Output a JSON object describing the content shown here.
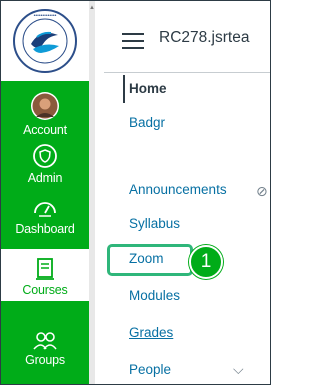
{
  "header": {
    "crumb": "RC278.jsrtea"
  },
  "global_nav": {
    "logo_icon": "college-seal-logo",
    "items": [
      {
        "label": "Account",
        "icon": "avatar-icon"
      },
      {
        "label": "Admin",
        "icon": "shield-icon"
      },
      {
        "label": "Dashboard",
        "icon": "dashboard-icon"
      },
      {
        "label": "Courses",
        "icon": "book-icon"
      },
      {
        "label": "Groups",
        "icon": "groups-icon"
      }
    ]
  },
  "course_nav": {
    "items": [
      {
        "label": "Home"
      },
      {
        "label": "Badgr"
      },
      {
        "label": "Announcements"
      },
      {
        "label": "Syllabus"
      },
      {
        "label": "Zoom"
      },
      {
        "label": "Modules"
      },
      {
        "label": "Grades"
      },
      {
        "label": "People"
      }
    ]
  },
  "callout": {
    "number": "1"
  },
  "colors": {
    "nav_green": "#00ac18",
    "link_blue": "#0770a3",
    "text_dark": "#2d3b45",
    "highlight": "#2fb67a"
  }
}
